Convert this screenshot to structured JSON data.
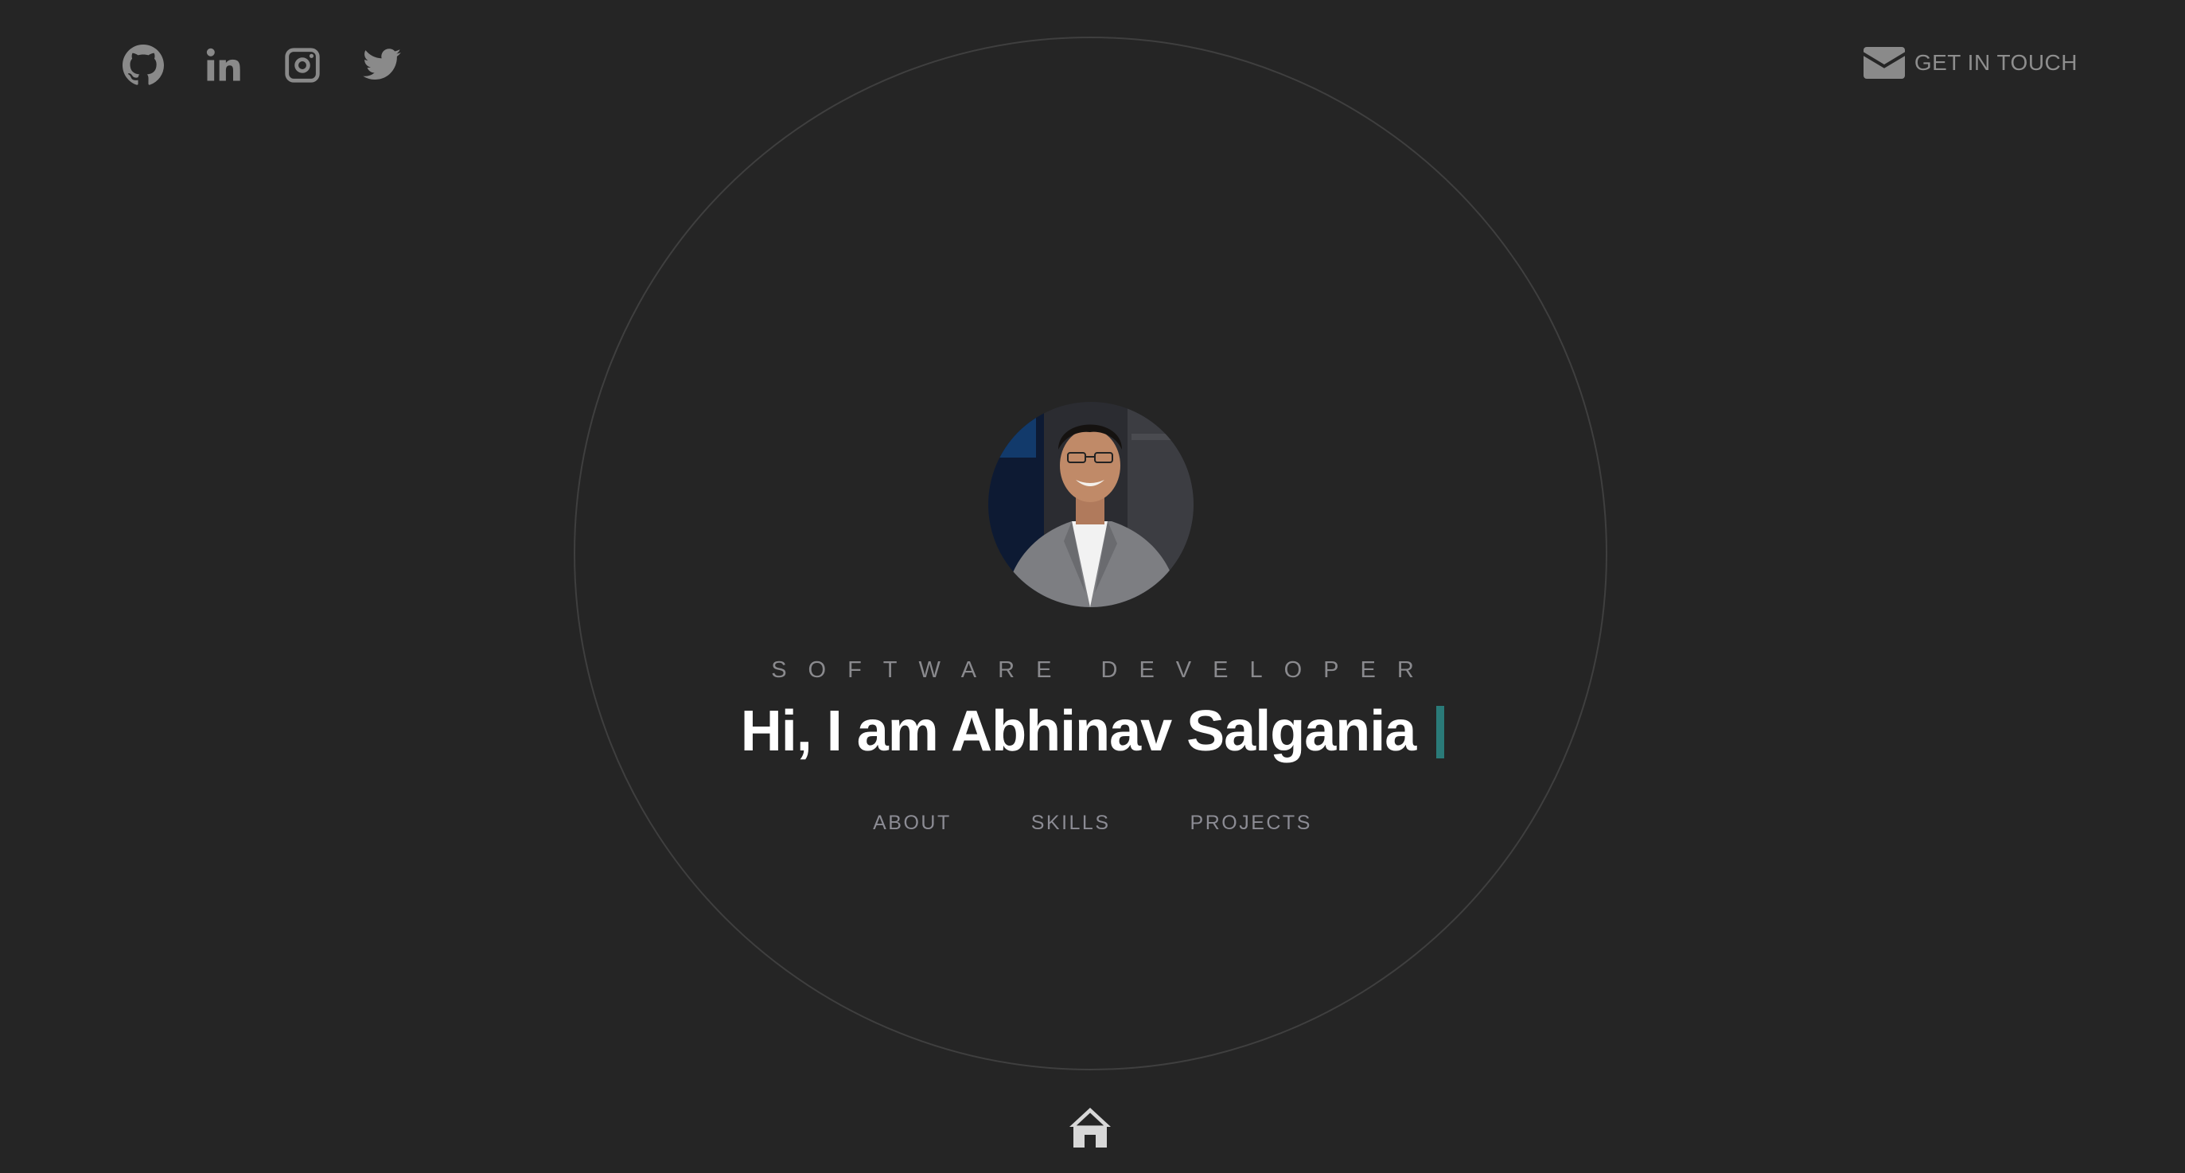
{
  "social": {
    "items": [
      {
        "icon": "github-icon"
      },
      {
        "icon": "linkedin-icon"
      },
      {
        "icon": "instagram-icon"
      },
      {
        "icon": "twitter-icon"
      }
    ]
  },
  "contact": {
    "icon": "envelope-icon",
    "label": "GET IN TOUCH"
  },
  "hero": {
    "avatar_icon": "profile-photo",
    "role": "SOFTWARE DEVELOPER",
    "headline": "Hi, I am Abhinav Salgania"
  },
  "nav": {
    "items": [
      {
        "label": "ABOUT"
      },
      {
        "label": "SKILLS"
      },
      {
        "label": "PROJECTS"
      }
    ]
  },
  "footer": {
    "home_icon": "home-icon"
  },
  "colors": {
    "background": "#252525",
    "accent": "#2a7a78",
    "icon": "#8a8a8a",
    "headline": "#ffffff"
  }
}
